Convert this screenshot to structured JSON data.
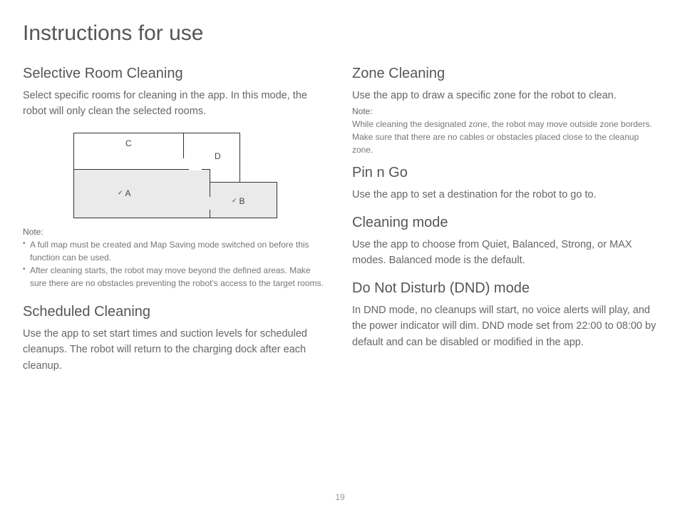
{
  "page": {
    "title": "Instructions for use",
    "pageNumber": "19"
  },
  "left": {
    "selective": {
      "heading": "Selective Room Cleaning",
      "body": "Select specific rooms for cleaning in the app. In this mode, the robot will only clean the selected rooms.",
      "rooms": {
        "a": "A",
        "b": "B",
        "c": "C",
        "d": "D"
      },
      "noteLabel": "Note:",
      "note1": "A full map must be created and Map Saving mode switched on before this function can be used.",
      "note2": "After cleaning starts, the robot may move beyond the defined areas. Make sure there are no obstacles preventing the robot's access to the target rooms."
    },
    "scheduled": {
      "heading": "Scheduled Cleaning",
      "body": "Use the app to set start times and suction levels for scheduled cleanups. The robot will return to the charging dock after each cleanup."
    }
  },
  "right": {
    "zone": {
      "heading": "Zone Cleaning",
      "body": "Use the app to draw a specific zone for the robot to clean.",
      "noteLabel": "Note:",
      "note": "While cleaning the designated zone, the robot may move outside zone borders. Make sure that there are no cables or obstacles placed close to the cleanup zone."
    },
    "pin": {
      "heading": "Pin n Go",
      "body": "Use the  app to set a destination for the robot to go to."
    },
    "mode": {
      "heading": "Cleaning mode",
      "body": "Use the app to choose from Quiet, Balanced, Strong, or MAX modes. Balanced mode is the default."
    },
    "dnd": {
      "heading": "Do Not Disturb (DND) mode",
      "body": "In DND mode, no cleanups will start, no voice alerts will play, and the power indicator will dim. DND mode set from 22:00 to 08:00 by default and can be disabled or modified in the app."
    }
  }
}
